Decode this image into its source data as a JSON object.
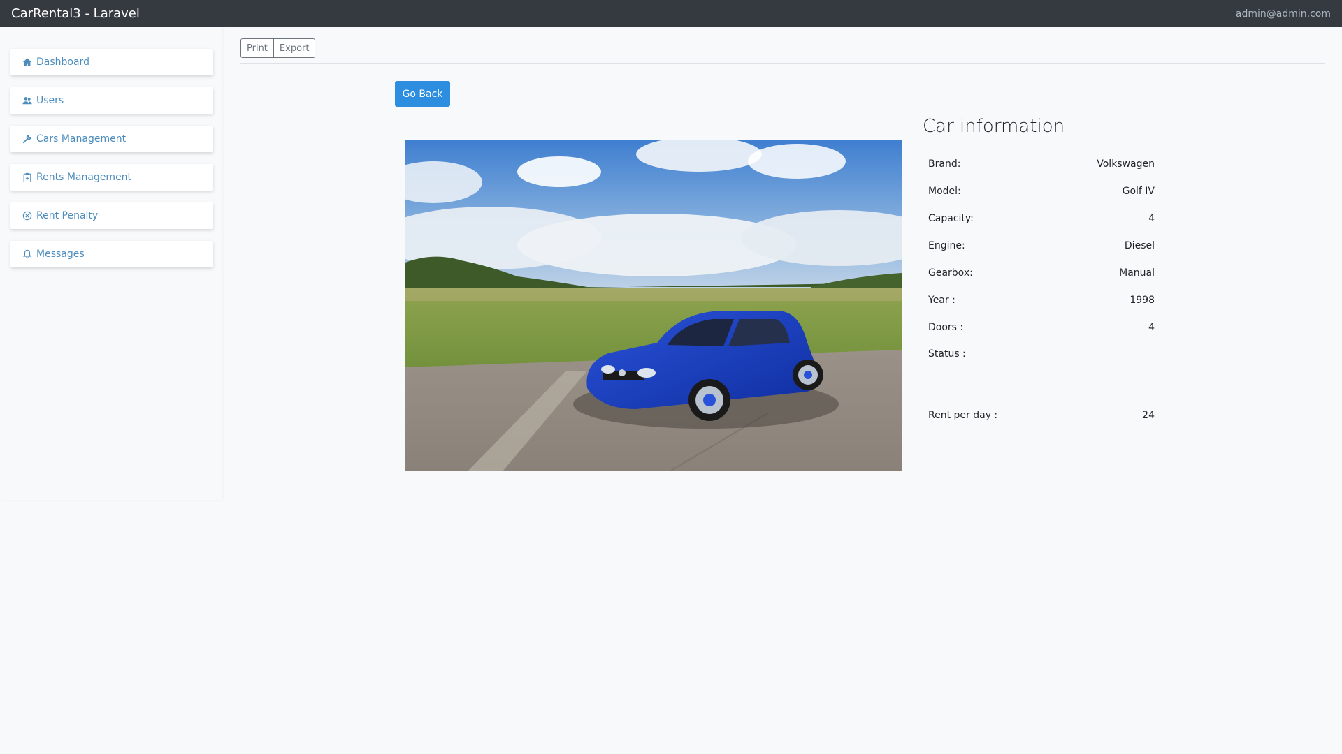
{
  "app": {
    "title": "CarRental3 - Laravel",
    "user_email": "admin@admin.com"
  },
  "sidebar": {
    "items": [
      {
        "label": "Dashboard",
        "icon": "home-icon"
      },
      {
        "label": "Users",
        "icon": "users-icon"
      },
      {
        "label": "Cars Management",
        "icon": "wrench-icon"
      },
      {
        "label": "Rents Management",
        "icon": "clipboard-icon"
      },
      {
        "label": "Rent Penalty",
        "icon": "x-circle-icon"
      },
      {
        "label": "Messages",
        "icon": "bell-icon"
      }
    ]
  },
  "toolbar": {
    "print_label": "Print",
    "export_label": "Export"
  },
  "actions": {
    "go_back_label": "Go Back"
  },
  "car_info": {
    "title": "Car information",
    "rows": [
      {
        "label": "Brand:",
        "value": "Volkswagen"
      },
      {
        "label": "Model:",
        "value": "Golf IV"
      },
      {
        "label": "Capacity:",
        "value": "4"
      },
      {
        "label": "Engine:",
        "value": "Diesel"
      },
      {
        "label": "Gearbox:",
        "value": "Manual"
      },
      {
        "label": "Year :",
        "value": "1998"
      },
      {
        "label": "Doors :",
        "value": "4"
      },
      {
        "label": "Status :",
        "value": ""
      },
      {
        "label": "Rent per day :",
        "value": "24"
      }
    ]
  },
  "colors": {
    "topbar": "#343a40",
    "accent": "#2d8ee0",
    "nav_text": "#4d8dbd"
  }
}
